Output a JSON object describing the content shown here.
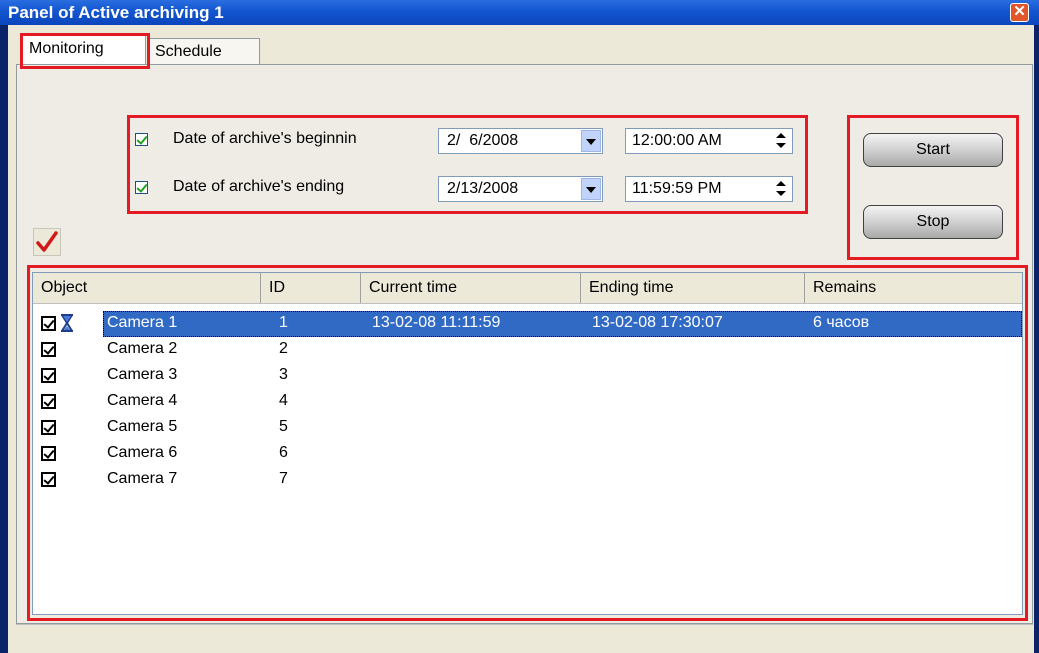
{
  "window": {
    "title": "Panel of Active archiving 1",
    "close_glyph": "✕",
    "accent_color": "#e41b24"
  },
  "tabs": [
    {
      "label": "Monitoring",
      "active": true
    },
    {
      "label": "Schedule",
      "active": false
    }
  ],
  "filters": {
    "begin": {
      "checked": true,
      "label": "Date of archive's beginnin",
      "date": "2/  6/2008",
      "time": "12:00:00 AM"
    },
    "end": {
      "checked": true,
      "label": "Date of archive's ending",
      "date": "2/13/2008",
      "time": "11:59:59 PM"
    }
  },
  "buttons": {
    "start": "Start",
    "stop": "Stop"
  },
  "table": {
    "columns": [
      "Object",
      "ID",
      "Current time",
      "Ending time",
      "Remains"
    ],
    "rows": [
      {
        "checked": true,
        "object": "Camera 1",
        "id": "1",
        "current_time": "13-02-08 11:11:59",
        "ending_time": "13-02-08 17:30:07",
        "remains": "6 часов",
        "selected": true,
        "icon": "hourglass-icon"
      },
      {
        "checked": true,
        "object": "Camera 2",
        "id": "2",
        "current_time": "",
        "ending_time": "",
        "remains": ""
      },
      {
        "checked": true,
        "object": "Camera 3",
        "id": "3",
        "current_time": "",
        "ending_time": "",
        "remains": ""
      },
      {
        "checked": true,
        "object": "Camera 4",
        "id": "4",
        "current_time": "",
        "ending_time": "",
        "remains": ""
      },
      {
        "checked": true,
        "object": "Camera 5",
        "id": "5",
        "current_time": "",
        "ending_time": "",
        "remains": ""
      },
      {
        "checked": true,
        "object": "Camera 6",
        "id": "6",
        "current_time": "",
        "ending_time": "",
        "remains": ""
      },
      {
        "checked": true,
        "object": "Camera 7",
        "id": "7",
        "current_time": "",
        "ending_time": "",
        "remains": ""
      }
    ]
  }
}
